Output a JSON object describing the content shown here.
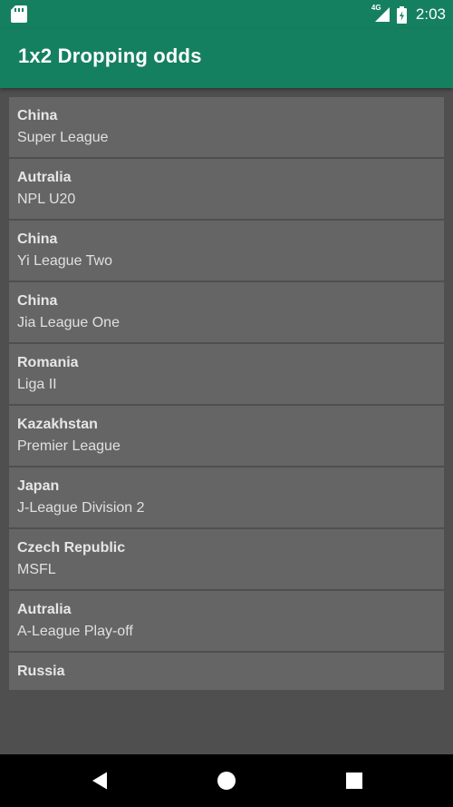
{
  "status_bar": {
    "network": "4G",
    "time": "2:03"
  },
  "app_bar": {
    "title": "1x2 Dropping odds"
  },
  "leagues": [
    {
      "country": "China",
      "league": "Super League"
    },
    {
      "country": "Autralia",
      "league": "NPL U20"
    },
    {
      "country": "China",
      "league": "Yi League Two"
    },
    {
      "country": "China",
      "league": "Jia League One"
    },
    {
      "country": "Romania",
      "league": "Liga II"
    },
    {
      "country": "Kazakhstan",
      "league": "Premier League"
    },
    {
      "country": "Japan",
      "league": "J-League Division 2"
    },
    {
      "country": "Czech Republic",
      "league": "MSFL"
    },
    {
      "country": "Autralia",
      "league": "A-League Play-off"
    },
    {
      "country": "Russia",
      "league": ""
    }
  ],
  "colors": {
    "primary": "#15805f",
    "background": "#4f4f4f",
    "card": "#656565"
  },
  "nav_icons": [
    "back-icon",
    "home-icon",
    "recents-icon"
  ]
}
